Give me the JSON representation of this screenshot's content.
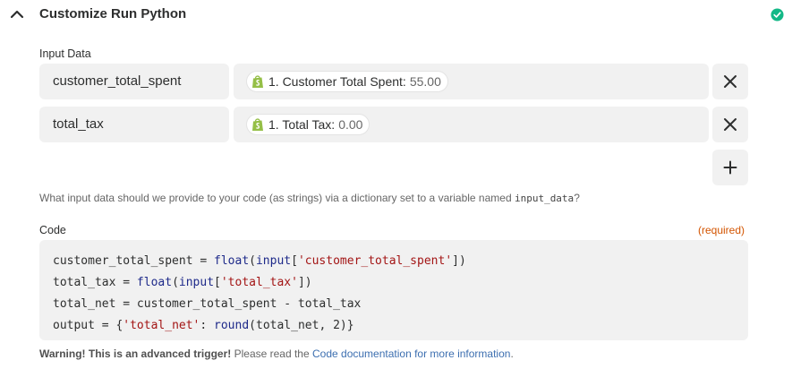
{
  "header": {
    "title": "Customize Run Python"
  },
  "input_data": {
    "label": "Input Data",
    "rows": [
      {
        "key": "customer_total_spent",
        "value_label": "1. Customer Total Spent:",
        "value": "55.00"
      },
      {
        "key": "total_tax",
        "value_label": "1. Total Tax:",
        "value": "0.00"
      }
    ],
    "help_prefix": "What input data should we provide to your code (as strings) via a dictionary set to a variable named ",
    "help_var": "input_data",
    "help_suffix": "?"
  },
  "code": {
    "label": "Code",
    "required": "(required)",
    "lines": [
      [
        {
          "t": "customer_total_spent = "
        },
        {
          "t": "float",
          "c": "fn"
        },
        {
          "t": "("
        },
        {
          "t": "input",
          "c": "fn"
        },
        {
          "t": "["
        },
        {
          "t": "'customer_total_spent'",
          "c": "s"
        },
        {
          "t": "])"
        }
      ],
      [
        {
          "t": "total_tax = "
        },
        {
          "t": "float",
          "c": "fn"
        },
        {
          "t": "("
        },
        {
          "t": "input",
          "c": "fn"
        },
        {
          "t": "["
        },
        {
          "t": "'total_tax'",
          "c": "s"
        },
        {
          "t": "])"
        }
      ],
      [
        {
          "t": "total_net = customer_total_spent - total_tax"
        }
      ],
      [
        {
          "t": "output = {"
        },
        {
          "t": "'total_net'",
          "c": "s"
        },
        {
          "t": ": "
        },
        {
          "t": "round",
          "c": "fn"
        },
        {
          "t": "(total_net, 2)}"
        }
      ]
    ]
  },
  "warning": {
    "bold": "Warning! This is an advanced trigger!",
    "text": " Please read the ",
    "link": "Code documentation for more information",
    "end": "."
  },
  "colors": {
    "accent_green": "#13b886",
    "shopify_green": "#95bf47",
    "required": "#d35400",
    "link": "#3d6fb0"
  },
  "icons": {
    "collapse": "chevron-up-icon",
    "status": "check-circle-icon",
    "app": "shopify-icon",
    "remove": "close-icon",
    "add": "plus-icon"
  }
}
